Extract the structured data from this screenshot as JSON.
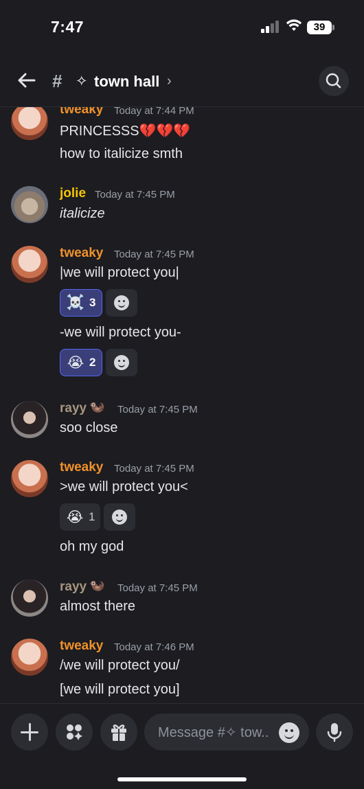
{
  "status_bar": {
    "time": "7:47",
    "battery": "39"
  },
  "header": {
    "channel_name": "town hall",
    "channel_prefix": "✧",
    "chevron": "›"
  },
  "messages": [
    {
      "user": "tweaky",
      "time": "Today at 7:44 PM",
      "lines": [
        "PRINCESSS💔💔💔",
        "how to italicize smth"
      ]
    },
    {
      "user": "jolie",
      "time": "Today at 7:45 PM",
      "lines": [
        "italicize"
      ]
    },
    {
      "user": "tweaky",
      "time": "Today at 7:45 PM",
      "lines": [
        "|we will protect you|",
        "-we will protect you-"
      ],
      "reactions": [
        {
          "emoji": "☠️",
          "count": "3"
        },
        {
          "emoji": "😭",
          "count": "2"
        }
      ]
    },
    {
      "user": "rayy",
      "tag": "🦦",
      "time": "Today at 7:45 PM",
      "lines": [
        "soo close"
      ]
    },
    {
      "user": "tweaky",
      "time": "Today at 7:45 PM",
      "lines": [
        ">we will protect you<",
        "oh my god"
      ],
      "reactions": [
        {
          "emoji": "😭",
          "count": "1"
        }
      ]
    },
    {
      "user": "rayy",
      "tag": "🦦",
      "time": "Today at 7:45 PM",
      "lines": [
        "almost there"
      ]
    },
    {
      "user": "tweaky",
      "time": "Today at 7:46 PM",
      "lines": [
        "/we will protect you/",
        "[we will protect you]"
      ]
    }
  ],
  "composer": {
    "placeholder": "Message #✧ tow.."
  },
  "icons": {
    "back": "arrow-left-icon",
    "hash": "hash-icon",
    "search": "search-icon",
    "add": "plus-icon",
    "apps": "apps-icon",
    "gift": "gift-icon",
    "emoji": "smiley-icon",
    "mic": "microphone-icon"
  },
  "colors": {
    "background": "#1c1c21",
    "tweaky": "#f0922a",
    "jolie": "#f5c400",
    "rayy": "#a79580",
    "reaction_active": "#5865f2"
  }
}
